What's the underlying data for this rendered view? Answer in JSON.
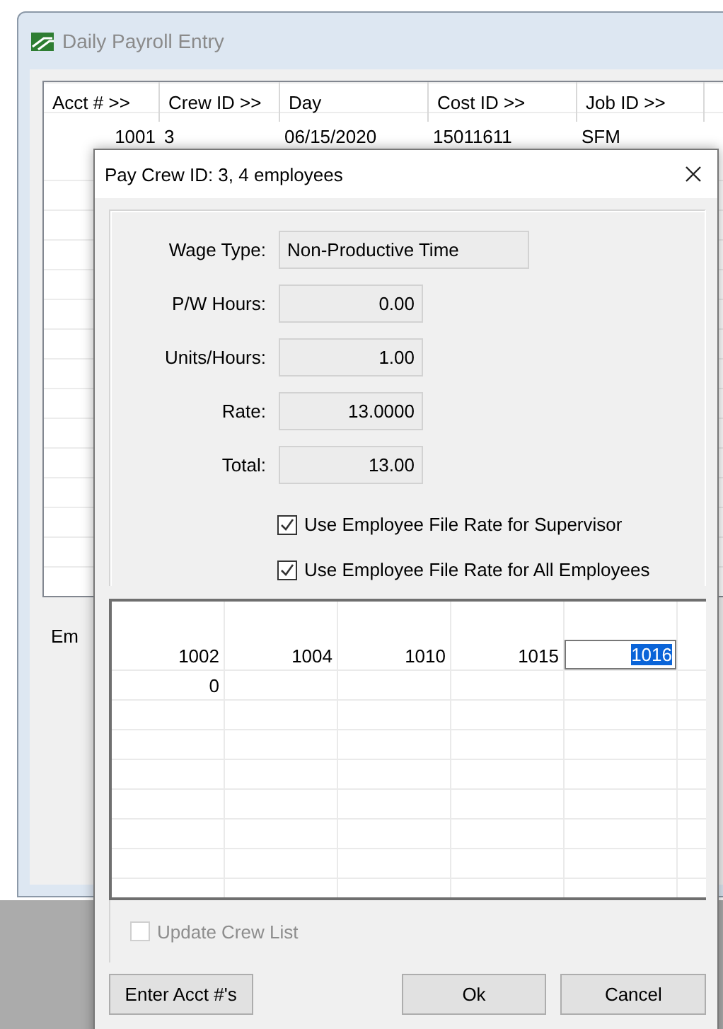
{
  "back_window": {
    "title": "Daily Payroll Entry",
    "active": false,
    "columns": [
      "Acct # >>",
      "Crew ID >>",
      "Day",
      "Cost ID >>",
      "Job ID >>"
    ],
    "rows": [
      [
        "1001",
        "3",
        "06/15/2020",
        "15011611",
        "SFM"
      ]
    ],
    "side_label": "Em"
  },
  "dialog": {
    "title": "Pay Crew ID: 3, 4 employees",
    "fields": [
      {
        "label": "Wage Type:",
        "value": "Non-Productive Time",
        "kind": "text"
      },
      {
        "label": "P/W Hours:",
        "value": "0.00",
        "kind": "number"
      },
      {
        "label": "Units/Hours:",
        "value": "1.00",
        "kind": "number"
      },
      {
        "label": "Rate:",
        "value": "13.0000",
        "kind": "number"
      },
      {
        "label": "Total:",
        "value": "13.00",
        "kind": "number"
      }
    ],
    "options": [
      {
        "label": "Use Employee File Rate for Supervisor",
        "checked": true
      },
      {
        "label": "Use Employee File Rate for All Employees",
        "checked": true
      }
    ],
    "crew_grid": {
      "rows": [
        {
          "cells": [
            {
              "text": "1002",
              "selected": false
            },
            {
              "text": "1004",
              "selected": false
            },
            {
              "text": "1010",
              "selected": false
            },
            {
              "text": "1015",
              "selected": false
            },
            {
              "text": "1016",
              "selected": true
            }
          ]
        },
        {
          "cells": [
            {
              "text": "0",
              "selected": false
            }
          ]
        }
      ]
    },
    "update_crew_list": {
      "label": "Update Crew List",
      "checked": false,
      "disabled": true
    },
    "buttons": [
      {
        "label": "Enter Acct #'s",
        "kind": "left"
      },
      {
        "label": "Ok",
        "kind": "right"
      },
      {
        "label": "Cancel",
        "kind": "right"
      }
    ]
  }
}
